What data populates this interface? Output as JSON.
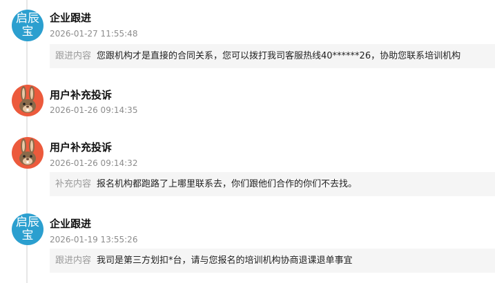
{
  "entries": [
    {
      "avatar_type": "company",
      "avatar_text": [
        "启辰",
        "宝"
      ],
      "title": "企业跟进",
      "time": "2026-01-27 11:55:48",
      "content_label": "跟进内容",
      "content_text": "您跟机构才是直接的合同关系，您可以拨打我司客服热线40******26，协助您联系培训机构"
    },
    {
      "avatar_type": "user",
      "title": "用户补充投诉",
      "time": "2026-01-26 09:14:35"
    },
    {
      "avatar_type": "user",
      "title": "用户补充投诉",
      "time": "2026-01-26 09:14:32",
      "content_label": "补充内容",
      "content_text": "报名机构都跑路了上哪里联系去，你们跟他们合作的你们不去找。"
    },
    {
      "avatar_type": "company",
      "avatar_text": [
        "启辰",
        "宝"
      ],
      "title": "企业跟进",
      "time": "2026-01-19 13:55:26",
      "content_label": "跟进内容",
      "content_text": "我司是第三方划扣*台，请与您报名的培训机构协商退课退单事宜"
    }
  ],
  "colors": {
    "company_avatar": "#2b9fcf",
    "user_avatar": "#ec5a3c",
    "content_bg": "#f5f5f5",
    "timeline": "#e6e6e6"
  },
  "icons": {
    "company_avatar": "company-logo-avatar",
    "user_avatar": "rabbit-avatar-icon"
  }
}
